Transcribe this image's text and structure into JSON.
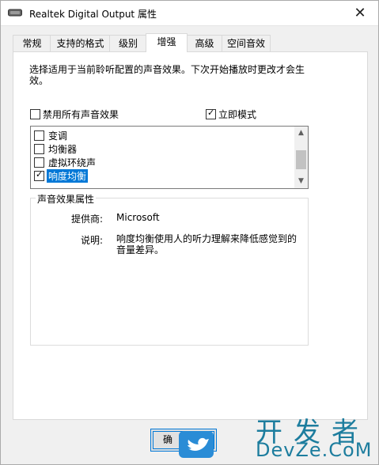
{
  "window": {
    "title": "Realtek Digital Output 属性",
    "close_glyph": "✕"
  },
  "tabs": [
    {
      "label": "常规"
    },
    {
      "label": "支持的格式"
    },
    {
      "label": "级别"
    },
    {
      "label": "增强",
      "active": true
    },
    {
      "label": "高级"
    },
    {
      "label": "空间音效"
    }
  ],
  "enhancements": {
    "description": "选择适用于当前聆听配置的声音效果。下次开始播放时更改才会生效。",
    "disable_all": {
      "label": "禁用所有声音效果",
      "checked": false
    },
    "immediate_mode": {
      "label": "立即模式",
      "checked": true
    },
    "effects": [
      {
        "label": "变调",
        "checked": false,
        "selected": false
      },
      {
        "label": "均衡器",
        "checked": false,
        "selected": false
      },
      {
        "label": "虚拟环绕声",
        "checked": false,
        "selected": false
      },
      {
        "label": "响度均衡",
        "checked": true,
        "selected": true
      }
    ],
    "properties": {
      "group_title": "声音效果属性",
      "provider_label": "提供商:",
      "provider_value": "Microsoft",
      "description_label": "说明:",
      "description_value": "响度均衡使用人的听力理解来降低感觉到的音量差异。"
    }
  },
  "buttons": {
    "ok_label": "确"
  },
  "watermark": {
    "cn": "开发者",
    "en": "DevZe.CoM"
  },
  "icons": {
    "check": "✓",
    "scroll_up": "▲",
    "scroll_down": "▼"
  }
}
